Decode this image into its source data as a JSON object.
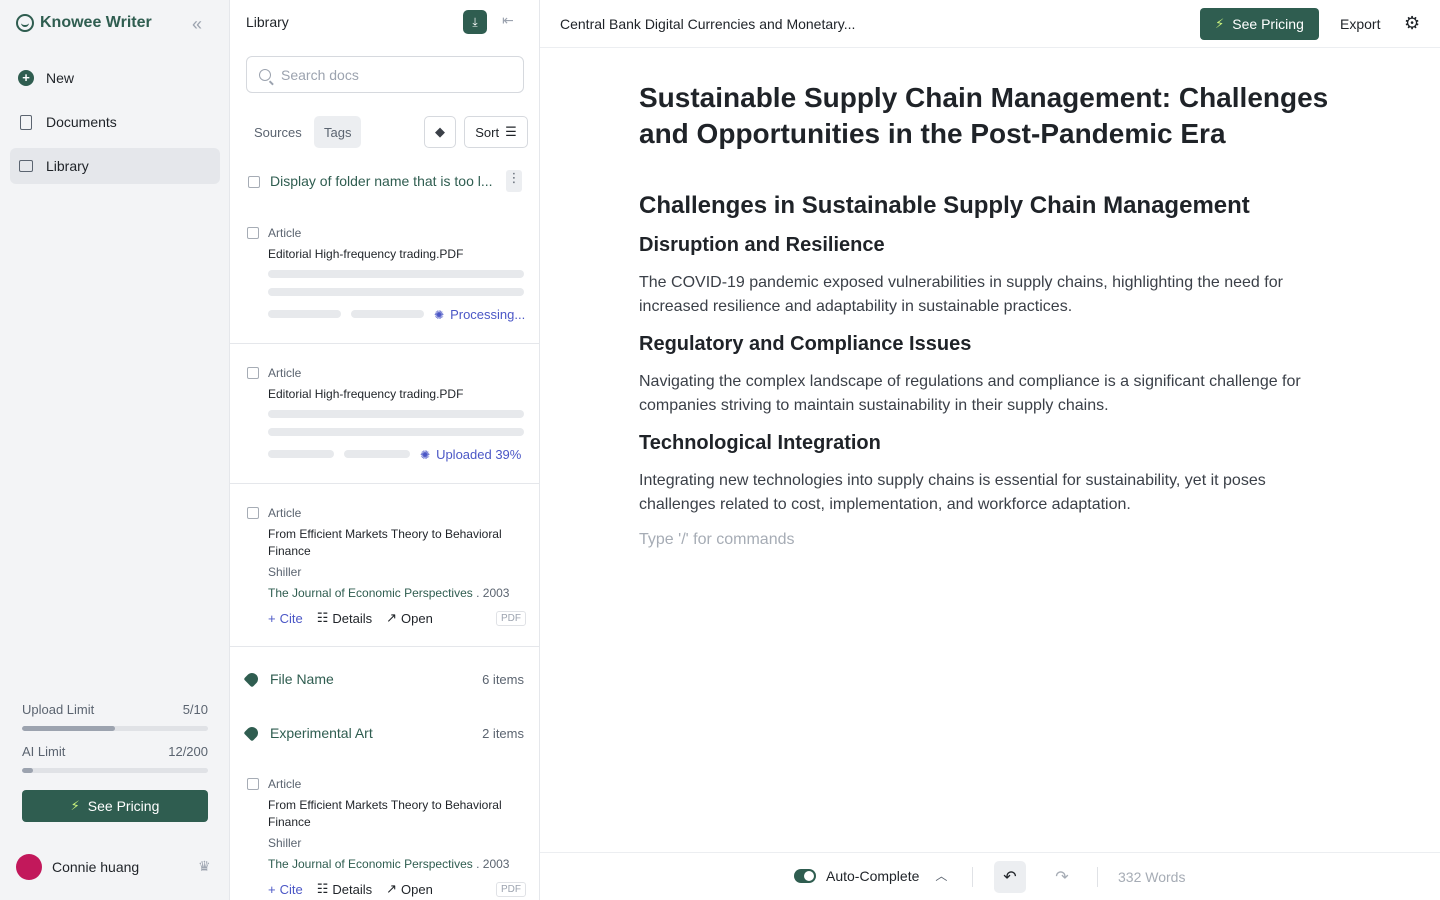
{
  "app": {
    "name": "Knowee Writer",
    "collapse_icon": "«"
  },
  "nav": [
    {
      "label": "New",
      "icon": "plus-circle-icon"
    },
    {
      "label": "Documents",
      "icon": "document-icon"
    },
    {
      "label": "Library",
      "icon": "library-icon",
      "active": true
    }
  ],
  "limits": {
    "upload": {
      "label": "Upload Limit",
      "value": "5/10",
      "fraction": 0.5
    },
    "ai": {
      "label": "AI Limit",
      "value": "12/200",
      "fraction": 0.06
    }
  },
  "pricing": {
    "label": "See Pricing"
  },
  "user": {
    "name": "Connie huang"
  },
  "library": {
    "title": "Library",
    "search_placeholder": "Search docs",
    "tabs": [
      "Sources",
      "Tags"
    ],
    "sort_label": "Sort",
    "folder": {
      "name": "Display of folder name that is too l..."
    },
    "items": [
      {
        "type": "Article",
        "title": "Editorial High-frequency trading.PDF",
        "status": "Processing..."
      },
      {
        "type": "Article",
        "title": "Editorial High-frequency trading.PDF",
        "status": "Uploaded 39%"
      },
      {
        "type": "Article",
        "title": "From Efficient Markets Theory to Behavioral Finance",
        "author": "Shiller",
        "journal": "The Journal of Economic Perspectives",
        "year": ". 2003",
        "badge": "PDF"
      },
      {
        "type": "Article",
        "title": "From Efficient Markets Theory to Behavioral Finance",
        "author": "Shiller",
        "journal": "The Journal of Economic Perspectives",
        "year": ". 2003",
        "badge": "PDF"
      }
    ],
    "tags": [
      {
        "name": "File Name",
        "count": "6 items"
      },
      {
        "name": "Experimental Art",
        "count": "2 items"
      }
    ],
    "actions": {
      "cite": "Cite",
      "details": "Details",
      "open": "Open"
    }
  },
  "editor": {
    "doc_title": "Central Bank Digital Currencies and Monetary...",
    "see_pricing": "See Pricing",
    "export": "Export",
    "h1": "Sustainable Supply Chain Management: Challenges and Opportunities in the Post-Pandemic Era",
    "h2": "Challenges in Sustainable Supply Chain Management",
    "sections": [
      {
        "heading": "Disruption and Resilience",
        "text": "The COVID-19 pandemic exposed vulnerabilities in supply chains, highlighting the need for increased resilience and adaptability in sustainable practices."
      },
      {
        "heading": "Regulatory and Compliance Issues",
        "text": "Navigating the complex landscape of regulations and compliance is a significant challenge for companies striving to maintain sustainability in their supply chains."
      },
      {
        "heading": "Technological Integration",
        "text": "Integrating new technologies into supply chains is essential for sustainability, yet it poses challenges related to cost, implementation, and workforce adaptation."
      }
    ],
    "command_placeholder": "Type '/' for commands"
  },
  "footer": {
    "autocomplete": "Auto-Complete",
    "words": "332 Words"
  },
  "colors": {
    "brand": "#2f5d50",
    "accent_link": "#4b57c6",
    "avatar": "#c2185b"
  }
}
